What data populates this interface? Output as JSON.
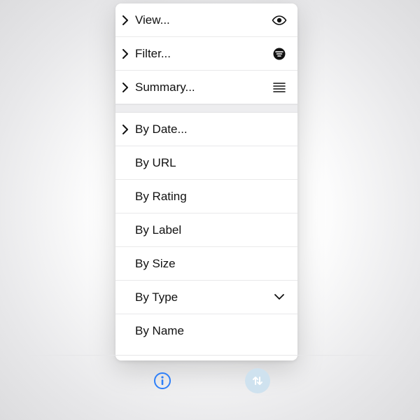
{
  "menu": {
    "top": [
      {
        "label": "View...",
        "icon": "eye",
        "expandable": true
      },
      {
        "label": "Filter...",
        "icon": "filter",
        "expandable": true
      },
      {
        "label": "Summary...",
        "icon": "lines",
        "expandable": true
      }
    ],
    "sort": [
      {
        "label": "By Date...",
        "expandable": true,
        "trailing": null
      },
      {
        "label": "By URL",
        "expandable": false,
        "trailing": null
      },
      {
        "label": "By Rating",
        "expandable": false,
        "trailing": null
      },
      {
        "label": "By Label",
        "expandable": false,
        "trailing": null
      },
      {
        "label": "By Size",
        "expandable": false,
        "trailing": null
      },
      {
        "label": "By Type",
        "expandable": false,
        "trailing": "chev-down"
      },
      {
        "label": "By Name",
        "expandable": false,
        "trailing": null
      }
    ]
  },
  "toolbar": {
    "info_icon": "info",
    "sort_icon": "sort"
  },
  "colors": {
    "text": "#111111",
    "divider": "#e9e9ea",
    "accent": "#2d7ff9",
    "sort_button_bg": "#cfe2ef"
  }
}
